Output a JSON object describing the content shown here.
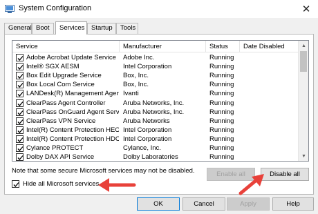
{
  "window": {
    "title": "System Configuration",
    "close_glyph": "✕"
  },
  "tabs": [
    {
      "label": "General"
    },
    {
      "label": "Boot"
    },
    {
      "label": "Services",
      "active": true
    },
    {
      "label": "Startup"
    },
    {
      "label": "Tools"
    }
  ],
  "table": {
    "columns": [
      "Service",
      "Manufacturer",
      "Status",
      "Date Disabled"
    ],
    "rows": [
      {
        "service": "Adobe Acrobat Update Service",
        "manufacturer": "Adobe Inc.",
        "status": "Running",
        "checked": true
      },
      {
        "service": "Intel® SGX AESM",
        "manufacturer": "Intel Corporation",
        "status": "Running",
        "checked": true
      },
      {
        "service": "Box Edit Upgrade Service",
        "manufacturer": "Box, Inc.",
        "status": "Running",
        "checked": true
      },
      {
        "service": "Box Local Com Service",
        "manufacturer": "Box, Inc.",
        "status": "Running",
        "checked": true
      },
      {
        "service": "LANDesk(R) Management Agent",
        "manufacturer": "Ivanti",
        "status": "Running",
        "checked": true
      },
      {
        "service": "ClearPass Agent Controller",
        "manufacturer": "Aruba Networks, Inc.",
        "status": "Running",
        "checked": true
      },
      {
        "service": "ClearPass OnGuard Agent Service",
        "manufacturer": "Aruba Networks, Inc.",
        "status": "Running",
        "checked": true
      },
      {
        "service": "ClearPass VPN Service",
        "manufacturer": "Aruba Networks",
        "status": "Running",
        "checked": true
      },
      {
        "service": "Intel(R) Content Protection HEC...",
        "manufacturer": "Intel Corporation",
        "status": "Running",
        "checked": true
      },
      {
        "service": "Intel(R) Content Protection HDC...",
        "manufacturer": "Intel Corporation",
        "status": "Running",
        "checked": true
      },
      {
        "service": "Cylance PROTECT",
        "manufacturer": "Cylance, Inc.",
        "status": "Running",
        "checked": true
      },
      {
        "service": "Dolby DAX API Service",
        "manufacturer": "Dolby Laboratories",
        "status": "Running",
        "checked": true
      }
    ]
  },
  "note": "Note that some secure Microsoft services may not be disabled.",
  "buttons": {
    "enable_all": "Enable all",
    "disable_all": "Disable all",
    "ok": "OK",
    "cancel": "Cancel",
    "apply": "Apply",
    "help": "Help"
  },
  "hide_ms": {
    "label": "Hide all Microsoft services",
    "checked": true
  },
  "colors": {
    "accent": "#0078d7",
    "arrow": "#e8413a"
  }
}
